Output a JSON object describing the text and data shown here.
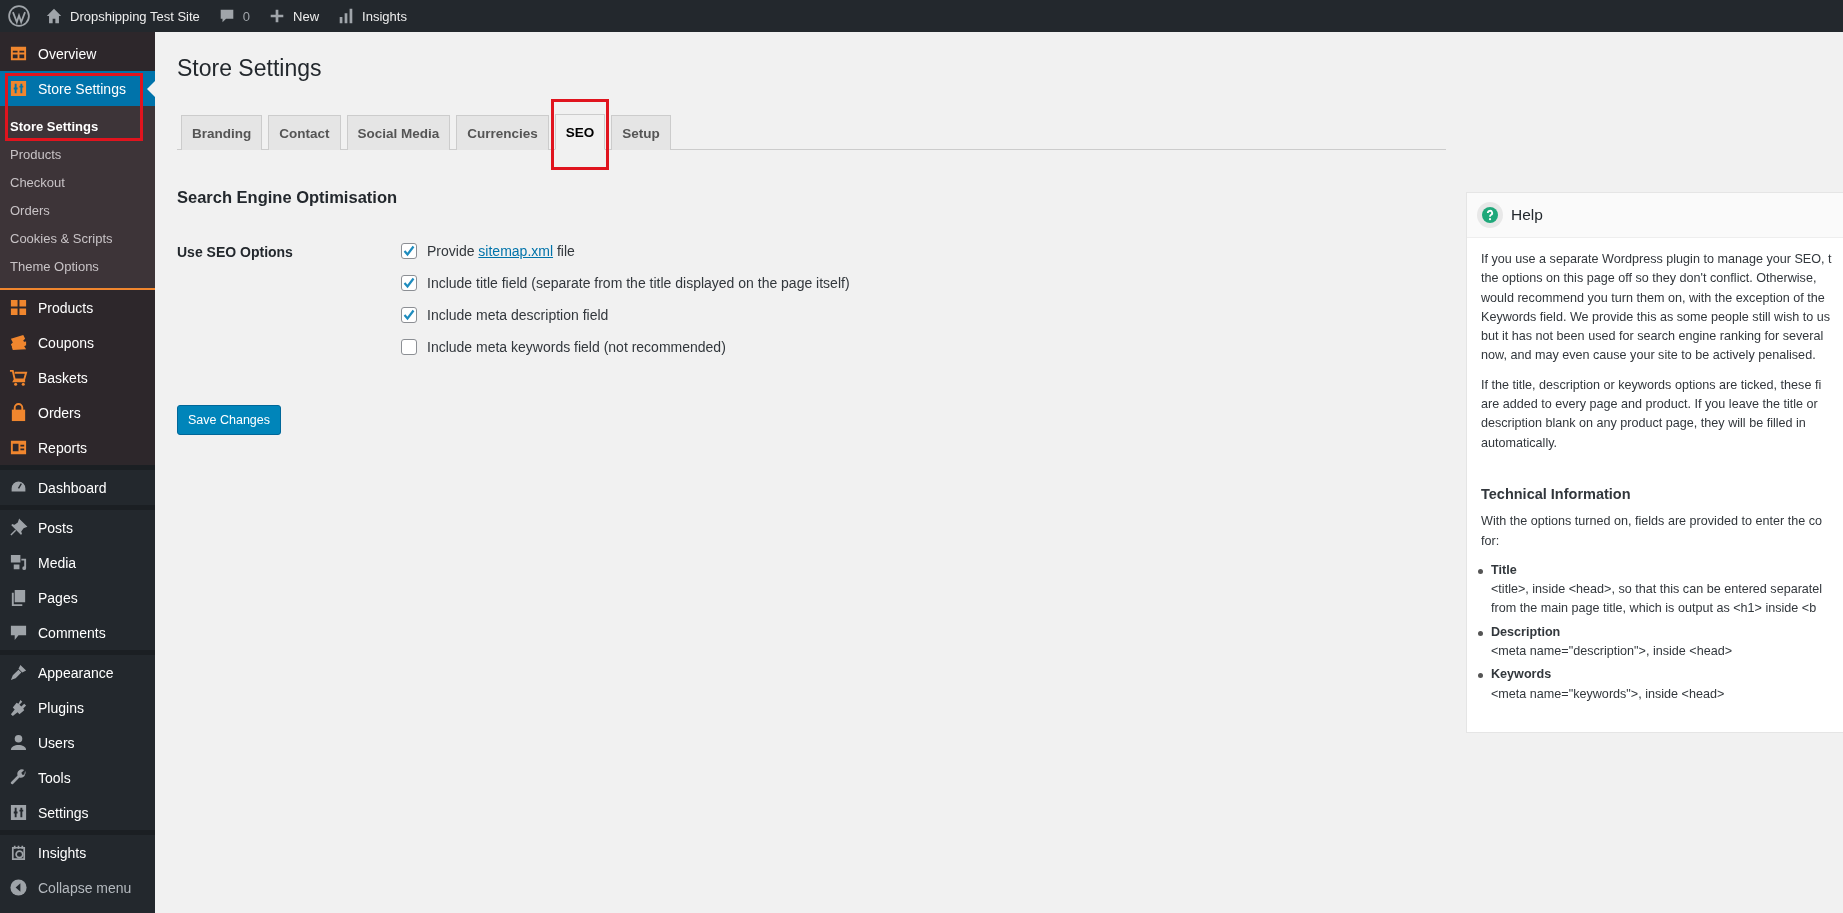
{
  "admin_bar": {
    "items": [
      {
        "kind": "logo"
      },
      {
        "kind": "home",
        "label": "Dropshipping Test Site"
      },
      {
        "kind": "comments",
        "label": "0"
      },
      {
        "kind": "new",
        "label": "New"
      },
      {
        "kind": "insights",
        "label": "Insights"
      }
    ]
  },
  "sidebar": {
    "groups": [
      {
        "kind": "store",
        "items": [
          {
            "label": "Overview",
            "current": false,
            "annotated": false
          },
          {
            "label": "Store Settings",
            "current": true,
            "annotated": true,
            "children": [
              {
                "label": "Store Settings",
                "selected": true
              },
              {
                "label": "Products",
                "selected": false
              },
              {
                "label": "Checkout",
                "selected": false
              },
              {
                "label": "Orders",
                "selected": false
              },
              {
                "label": "Cookies & Scripts",
                "selected": false
              },
              {
                "label": "Theme Options",
                "selected": false
              }
            ]
          }
        ]
      },
      {
        "kind": "store",
        "items": [
          {
            "label": "Products",
            "current": false,
            "annotated": false
          },
          {
            "label": "Coupons",
            "current": false,
            "annotated": false
          },
          {
            "label": "Baskets",
            "current": false,
            "annotated": false
          },
          {
            "label": "Orders",
            "current": false,
            "annotated": false
          },
          {
            "label": "Reports",
            "current": false,
            "annotated": false
          }
        ]
      },
      {
        "kind": "wp",
        "items": [
          {
            "label": "Dashboard",
            "current": false,
            "annotated": false
          }
        ]
      },
      {
        "kind": "wp",
        "items": [
          {
            "label": "Posts",
            "current": false,
            "annotated": false
          },
          {
            "label": "Media",
            "current": false,
            "annotated": false
          },
          {
            "label": "Pages",
            "current": false,
            "annotated": false
          },
          {
            "label": "Comments",
            "current": false,
            "annotated": false
          }
        ]
      },
      {
        "kind": "wp",
        "items": [
          {
            "label": "Appearance",
            "current": false,
            "annotated": false
          },
          {
            "label": "Plugins",
            "current": false,
            "annotated": false
          },
          {
            "label": "Users",
            "current": false,
            "annotated": false
          },
          {
            "label": "Tools",
            "current": false,
            "annotated": false
          },
          {
            "label": "Settings",
            "current": false,
            "annotated": false
          }
        ]
      },
      {
        "kind": "wp",
        "items": [
          {
            "label": "Insights",
            "current": false,
            "annotated": false
          },
          {
            "label": "Collapse menu",
            "current": false,
            "annotated": false
          }
        ]
      }
    ]
  },
  "page": {
    "title": "Store Settings",
    "tabs": [
      {
        "label": "Branding",
        "selected": false,
        "annotated": false
      },
      {
        "label": "Contact",
        "selected": false,
        "annotated": false
      },
      {
        "label": "Social Media",
        "selected": false,
        "annotated": false
      },
      {
        "label": "Currencies",
        "selected": false,
        "annotated": false
      },
      {
        "label": "SEO",
        "selected": true,
        "annotated": true
      },
      {
        "label": "Setup",
        "selected": false,
        "annotated": false
      }
    ],
    "section_title": "Search Engine Optimisation",
    "field_label": "Use SEO Options",
    "options": [
      {
        "before": "Provide ",
        "link": "sitemap.xml",
        "after": " file",
        "checked": true
      },
      {
        "before": "Include title field (separate from the title displayed on the page itself)",
        "checked": true
      },
      {
        "before": "Include meta description field",
        "checked": true
      },
      {
        "before": "Include meta keywords field (not recommended)",
        "checked": false
      }
    ],
    "save_button": "Save Changes"
  },
  "help": {
    "title": "Help",
    "paragraphs": [
      [
        "If you use a separate Wordpress plugin to manage your SEO, t",
        "the options on this page off so they don't conflict. Otherwise,",
        "would recommend you turn them on, with the exception of the",
        "Keywords field. We provide this as some people still wish to us",
        "but it has not been used for search engine ranking for several",
        "now, and may even cause your site to be actively penalised."
      ],
      [
        "If the title, description or keywords options are ticked, these fi",
        "are added to every page and product. If you leave the title or",
        "description blank on any product page, they will be filled in",
        "automatically."
      ]
    ],
    "technical_title": "Technical Information",
    "technical_intro": [
      "With the options turned on, fields are provided to enter the co",
      "for:"
    ],
    "items": [
      {
        "term": "Title",
        "lines": [
          "<title>, inside <head>, so that this can be entered separatel",
          "from the main page title, which is output as <h1> inside <b"
        ]
      },
      {
        "term": "Description",
        "lines": [
          "<meta name=\"description\">, inside <head>"
        ]
      },
      {
        "term": "Keywords",
        "lines": [
          "<meta name=\"keywords\">, inside <head>"
        ]
      }
    ]
  }
}
